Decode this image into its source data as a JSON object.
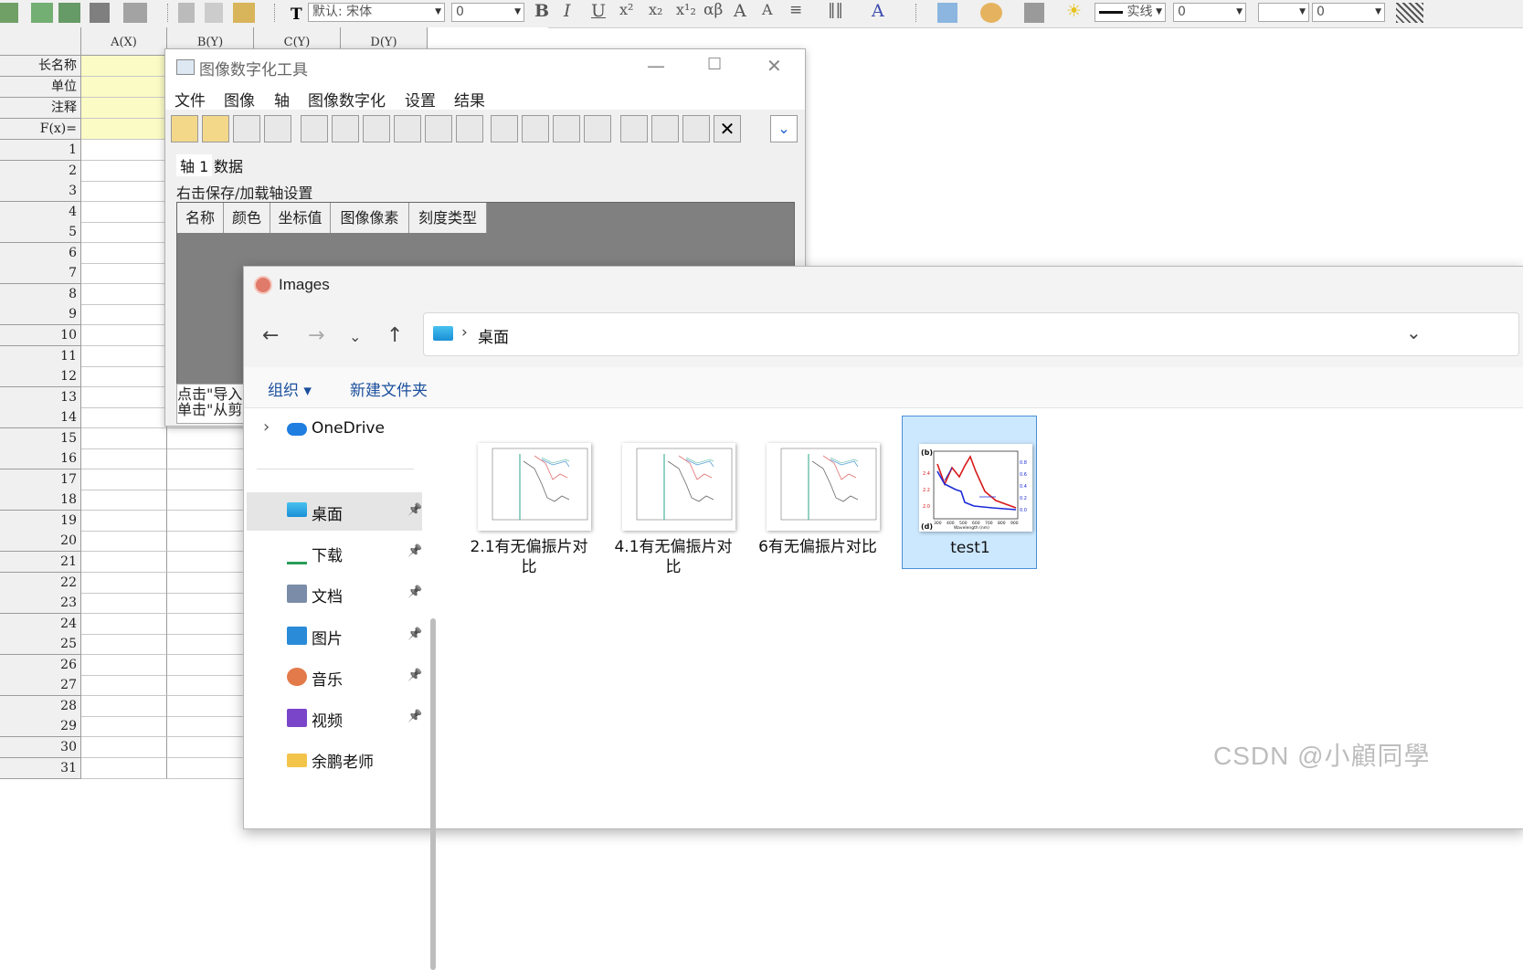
{
  "toolbar": {
    "font_combo": "默认: 宋体",
    "size_combo": "0",
    "greek_label": "αβ",
    "line_style": "实线",
    "num_combo_1": "0",
    "num_combo_2": "0"
  },
  "worksheet": {
    "columns": [
      "A(X)",
      "B(Y)",
      "C(Y)",
      "D(Y)"
    ],
    "meta_rows": [
      "长名称",
      "单位",
      "注释",
      "F(x)="
    ],
    "row_numbers": [
      "1",
      "2",
      "3",
      "4",
      "5",
      "6",
      "7",
      "8",
      "9",
      "10",
      "11",
      "12",
      "13",
      "14",
      "15",
      "16",
      "17",
      "18",
      "19",
      "20",
      "21",
      "22",
      "23",
      "24",
      "25",
      "26",
      "27",
      "28",
      "29",
      "30",
      "31"
    ]
  },
  "digitizer": {
    "title": "图像数字化工具",
    "menu": [
      "文件",
      "图像",
      "轴",
      "图像数字化",
      "设置",
      "结果"
    ],
    "tabs": [
      "轴 1",
      "数据"
    ],
    "hint": "右击保存/加载轴设置",
    "grid_columns": [
      "名称",
      "颜色",
      "坐标值",
      "图像像素",
      "刻度类型"
    ],
    "status_lines": [
      "点击\"导入",
      "单击\"从剪"
    ]
  },
  "explorer": {
    "title": "Images",
    "breadcrumb_sep": "›",
    "location": "桌面",
    "commands": {
      "organize": "组织",
      "new_folder": "新建文件夹"
    },
    "nav_items": [
      {
        "label": "OneDrive",
        "icon": "onedrive-icon"
      },
      {
        "label": "桌面",
        "icon": "desktop-icon",
        "pinned": true,
        "selected": true
      },
      {
        "label": "下载",
        "icon": "download-icon",
        "pinned": true
      },
      {
        "label": "文档",
        "icon": "documents-icon",
        "pinned": true
      },
      {
        "label": "图片",
        "icon": "pictures-icon",
        "pinned": true
      },
      {
        "label": "音乐",
        "icon": "music-icon",
        "pinned": true
      },
      {
        "label": "视频",
        "icon": "videos-icon",
        "pinned": true
      },
      {
        "label": "余鹏老师",
        "icon": "folder-icon"
      }
    ],
    "files": [
      {
        "name_line1": "2.1有无偏振片对",
        "name_line2": "比"
      },
      {
        "name_line1": "4.1有无偏振片对",
        "name_line2": "比"
      },
      {
        "name_line1": "6有无偏振片对比",
        "name_line2": ""
      },
      {
        "name_line1": "test1",
        "name_line2": "",
        "selected": true
      }
    ],
    "test1_thumb": {
      "panel_b": "(b)",
      "panel_d": "(d)",
      "xlabel": "Wavelength (nm)",
      "xticks": [
        "300",
        "400",
        "500",
        "600",
        "700",
        "800",
        "900"
      ],
      "left_ticks": [
        "2.4",
        "2.2",
        "2.0"
      ],
      "right_ticks": [
        "0.8",
        "0.6",
        "0.4",
        "0.2",
        "0.0"
      ]
    }
  },
  "watermark": "CSDN @小顧同學",
  "colors": {
    "selection": "#cce8ff",
    "accent": "#0078d4",
    "yellow_cells": "#fbfbc6"
  }
}
